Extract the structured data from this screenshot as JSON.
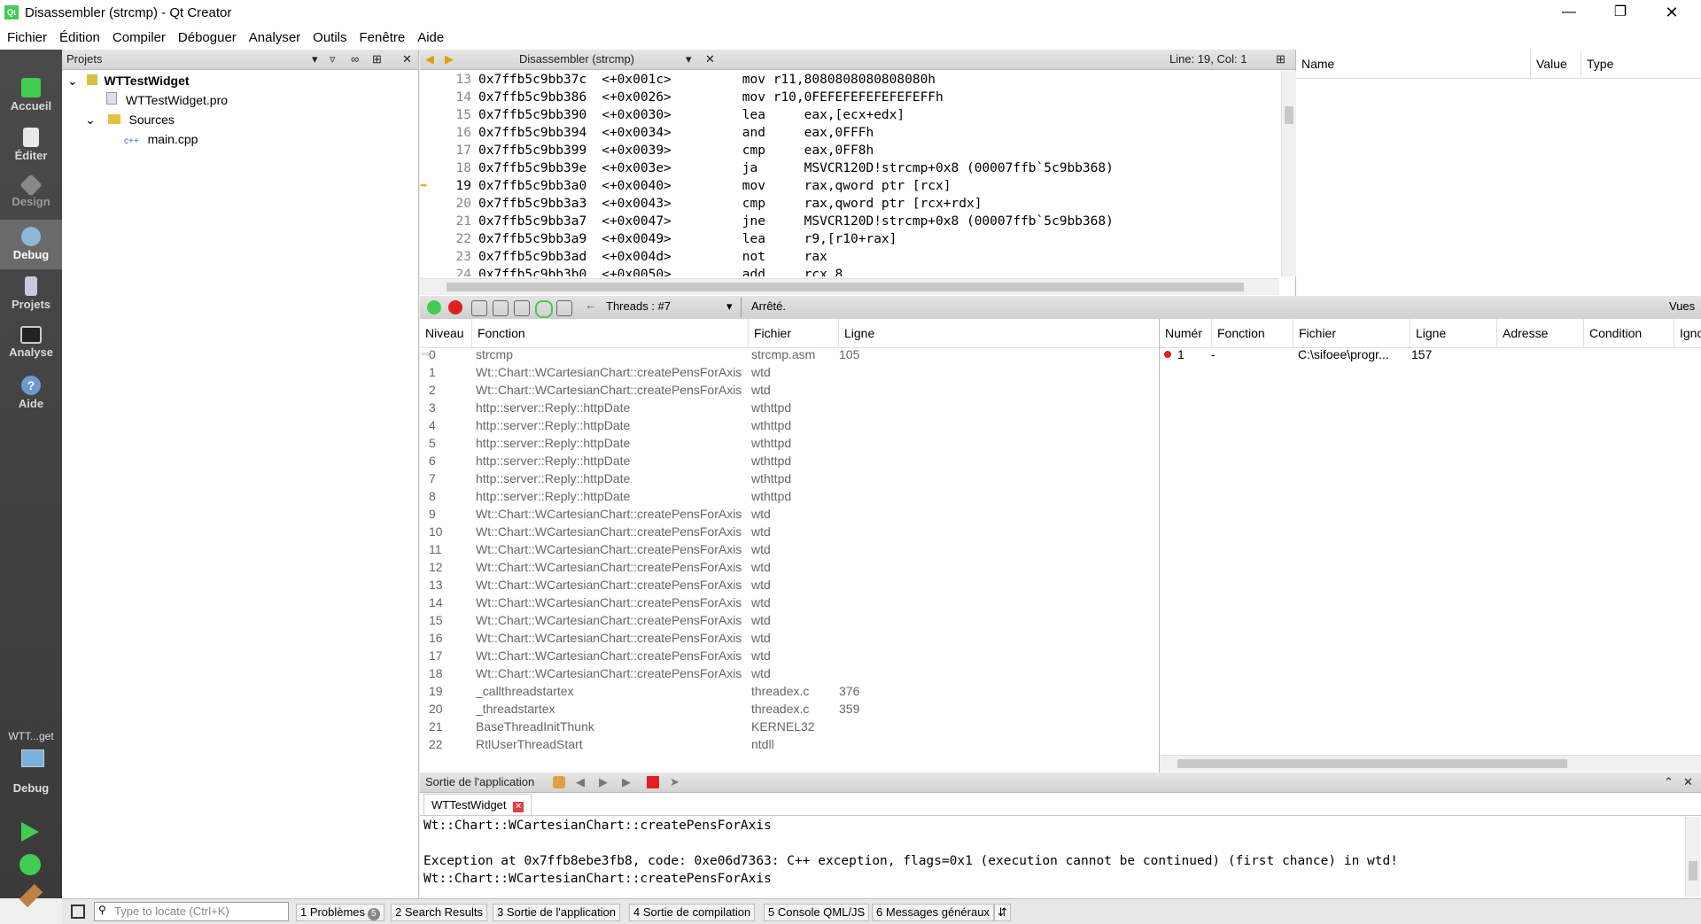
{
  "window": {
    "title": "Disassembler (strcmp) - Qt Creator",
    "logo": "Qt"
  },
  "menu": [
    "Fichier",
    "Édition",
    "Compiler",
    "Déboguer",
    "Analyser",
    "Outils",
    "Fenêtre",
    "Aide"
  ],
  "modes": [
    {
      "label": "Accueil",
      "icon": "qt-logo-icon"
    },
    {
      "label": "Éditer",
      "icon": "document-icon"
    },
    {
      "label": "Design",
      "icon": "pencil-icon"
    },
    {
      "label": "Debug",
      "icon": "bug-icon"
    },
    {
      "label": "Projets",
      "icon": "wrench-icon"
    },
    {
      "label": "Analyse",
      "icon": "monitor-icon"
    },
    {
      "label": "Aide",
      "icon": "help-icon"
    }
  ],
  "kit": {
    "target": "WTT...get",
    "mode": "Debug"
  },
  "projects": {
    "title": "Projets",
    "tree": [
      {
        "label": "WTTestWidget",
        "level": 0,
        "bold": true
      },
      {
        "label": "WTTestWidget.pro",
        "level": 1
      },
      {
        "label": "Sources",
        "level": 1
      },
      {
        "label": "main.cpp",
        "level": 2
      }
    ]
  },
  "editor": {
    "title": "Disassembler (strcmp)",
    "position": "Line: 19, Col: 1"
  },
  "disassembly": [
    {
      "ln": "13",
      "addr": "0x7ffb5c9bb37c",
      "off": "<+0x001c>",
      "instr": "mov r11,8080808080808080h"
    },
    {
      "ln": "14",
      "addr": "0x7ffb5c9bb386",
      "off": "<+0x0026>",
      "instr": "mov r10,0FEFEFEFEFEFEFEFFh"
    },
    {
      "ln": "15",
      "addr": "0x7ffb5c9bb390",
      "off": "<+0x0030>",
      "instr": "lea     eax,[ecx+edx]"
    },
    {
      "ln": "16",
      "addr": "0x7ffb5c9bb394",
      "off": "<+0x0034>",
      "instr": "and     eax,0FFFh"
    },
    {
      "ln": "17",
      "addr": "0x7ffb5c9bb399",
      "off": "<+0x0039>",
      "instr": "cmp     eax,0FF8h"
    },
    {
      "ln": "18",
      "addr": "0x7ffb5c9bb39e",
      "off": "<+0x003e>",
      "instr": "ja      MSVCR120D!strcmp+0x8 (00007ffb`5c9bb368)"
    },
    {
      "ln": "19",
      "addr": "0x7ffb5c9bb3a0",
      "off": "<+0x0040>",
      "instr": "mov     rax,qword ptr [rcx]"
    },
    {
      "ln": "20",
      "addr": "0x7ffb5c9bb3a3",
      "off": "<+0x0043>",
      "instr": "cmp     rax,qword ptr [rcx+rdx]"
    },
    {
      "ln": "21",
      "addr": "0x7ffb5c9bb3a7",
      "off": "<+0x0047>",
      "instr": "jne     MSVCR120D!strcmp+0x8 (00007ffb`5c9bb368)"
    },
    {
      "ln": "22",
      "addr": "0x7ffb5c9bb3a9",
      "off": "<+0x0049>",
      "instr": "lea     r9,[r10+rax]"
    },
    {
      "ln": "23",
      "addr": "0x7ffb5c9bb3ad",
      "off": "<+0x004d>",
      "instr": "not     rax"
    },
    {
      "ln": "24",
      "addr": "0x7ffb5c9bb3b0",
      "off": "<+0x0050>",
      "instr": "add     rcx,8"
    }
  ],
  "locals": {
    "headers": [
      "Name",
      "Value",
      "Type"
    ]
  },
  "debug_toolbar": {
    "threads": "Threads : #7",
    "status": "Arrêté.",
    "views": "Vues"
  },
  "stack": {
    "headers": [
      "Niveau",
      "Fonction",
      "Fichier",
      "Ligne"
    ],
    "rows": [
      {
        "level": "0",
        "fn": "strcmp",
        "file": "strcmp.asm",
        "line": "105"
      },
      {
        "level": "1",
        "fn": "Wt::Chart::WCartesianChart::createPensForAxis",
        "file": "wtd",
        "line": ""
      },
      {
        "level": "2",
        "fn": "Wt::Chart::WCartesianChart::createPensForAxis",
        "file": "wtd",
        "line": ""
      },
      {
        "level": "3",
        "fn": "http::server::Reply::httpDate",
        "file": "wthttpd",
        "line": ""
      },
      {
        "level": "4",
        "fn": "http::server::Reply::httpDate",
        "file": "wthttpd",
        "line": ""
      },
      {
        "level": "5",
        "fn": "http::server::Reply::httpDate",
        "file": "wthttpd",
        "line": ""
      },
      {
        "level": "6",
        "fn": "http::server::Reply::httpDate",
        "file": "wthttpd",
        "line": ""
      },
      {
        "level": "7",
        "fn": "http::server::Reply::httpDate",
        "file": "wthttpd",
        "line": ""
      },
      {
        "level": "8",
        "fn": "http::server::Reply::httpDate",
        "file": "wthttpd",
        "line": ""
      },
      {
        "level": "9",
        "fn": "Wt::Chart::WCartesianChart::createPensForAxis",
        "file": "wtd",
        "line": ""
      },
      {
        "level": "10",
        "fn": "Wt::Chart::WCartesianChart::createPensForAxis",
        "file": "wtd",
        "line": ""
      },
      {
        "level": "11",
        "fn": "Wt::Chart::WCartesianChart::createPensForAxis",
        "file": "wtd",
        "line": ""
      },
      {
        "level": "12",
        "fn": "Wt::Chart::WCartesianChart::createPensForAxis",
        "file": "wtd",
        "line": ""
      },
      {
        "level": "13",
        "fn": "Wt::Chart::WCartesianChart::createPensForAxis",
        "file": "wtd",
        "line": ""
      },
      {
        "level": "14",
        "fn": "Wt::Chart::WCartesianChart::createPensForAxis",
        "file": "wtd",
        "line": ""
      },
      {
        "level": "15",
        "fn": "Wt::Chart::WCartesianChart::createPensForAxis",
        "file": "wtd",
        "line": ""
      },
      {
        "level": "16",
        "fn": "Wt::Chart::WCartesianChart::createPensForAxis",
        "file": "wtd",
        "line": ""
      },
      {
        "level": "17",
        "fn": "Wt::Chart::WCartesianChart::createPensForAxis",
        "file": "wtd",
        "line": ""
      },
      {
        "level": "18",
        "fn": "Wt::Chart::WCartesianChart::createPensForAxis",
        "file": "wtd",
        "line": ""
      },
      {
        "level": "19",
        "fn": "_callthreadstartex",
        "file": "threadex.c",
        "line": "376"
      },
      {
        "level": "20",
        "fn": "_threadstartex",
        "file": "threadex.c",
        "line": "359"
      },
      {
        "level": "21",
        "fn": "BaseThreadInitThunk",
        "file": "KERNEL32",
        "line": ""
      },
      {
        "level": "22",
        "fn": "RtlUserThreadStart",
        "file": "ntdll",
        "line": ""
      }
    ]
  },
  "breakpoints": {
    "headers": [
      "Numér",
      "Fonction",
      "Fichier",
      "Ligne",
      "Adresse",
      "Condition",
      "Igno"
    ],
    "rows": [
      {
        "num": "1",
        "fn": "-",
        "file": "C:\\sifoee\\progr...",
        "line": "157"
      }
    ]
  },
  "output": {
    "title": "Sortie de l'application",
    "tab": "WTTestWidget",
    "lines": [
      "Wt::Chart::WCartesianChart::createPensForAxis",
      "",
      "Exception at 0x7ffb8ebe3fb8, code: 0xe06d7363: C++ exception, flags=0x1 (execution cannot be continued) (first chance) in wtd!",
      "Wt::Chart::WCartesianChart::createPensForAxis"
    ]
  },
  "statusbar": {
    "locate_placeholder": "Type to locate (Ctrl+K)",
    "tabs": [
      {
        "num": "1",
        "label": "Problèmes",
        "badge": "5"
      },
      {
        "num": "2",
        "label": "Search Results"
      },
      {
        "num": "3",
        "label": "Sortie de l'application"
      },
      {
        "num": "4",
        "label": "Sortie de compilation"
      },
      {
        "num": "5",
        "label": "Console QML/JS"
      },
      {
        "num": "6",
        "label": "Messages généraux"
      }
    ]
  },
  "colors": {
    "accent_green": "#41cd52",
    "breakpoint_red": "#e02020",
    "current_arrow": "#f0c020"
  }
}
